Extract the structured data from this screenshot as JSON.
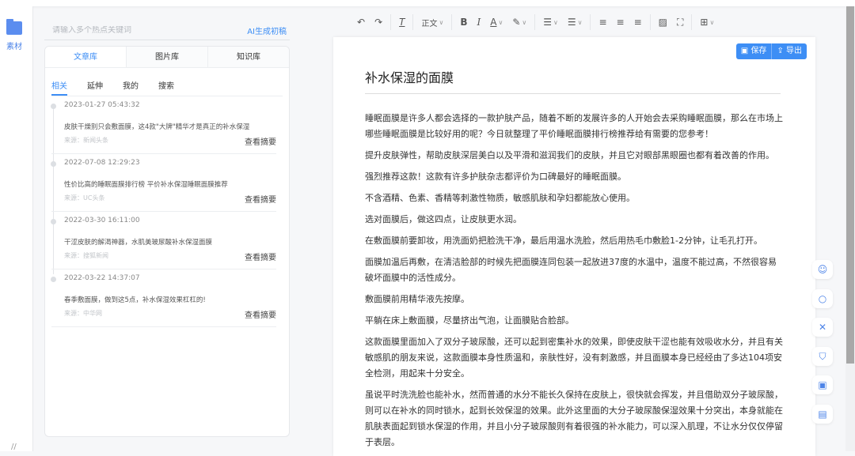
{
  "rail": {
    "label": "素材",
    "icon": "folder-icon"
  },
  "left": {
    "search_placeholder": "请输入多个热点关键词",
    "ai_button": "AI生成初稿",
    "tabs": [
      "文章库",
      "图片库",
      "知识库"
    ],
    "subtabs": [
      "相关",
      "延伸",
      "我的",
      "搜索"
    ],
    "items": [
      {
        "date": "2023-01-27 05:43:32",
        "title": "皮肤干燥别只会敷面膜，这4款\"大牌\"精华才是真正的补水保湿",
        "source": "来源：新闻头条",
        "action": "查看摘要"
      },
      {
        "date": "2022-07-08 12:29:23",
        "title": "性价比高的睡眠面膜排行榜 平价补水保湿睡眠面膜推荐",
        "source": "来源：UC头条",
        "action": "查看摘要"
      },
      {
        "date": "2022-03-30 16:11:00",
        "title": "干涩皮肤的解渴神器，水肌美玻尿酸补水保湿面膜",
        "source": "来源：搜狐新闻",
        "action": "查看摘要"
      },
      {
        "date": "2022-03-22 14:37:07",
        "title": "春季敷面膜，做到这5点，补水保湿效果杠杠的!",
        "source": "来源：中华网",
        "action": "查看摘要"
      }
    ]
  },
  "toolbar": {
    "paragraph_style": "正文"
  },
  "doc": {
    "save": "保存",
    "export": "导出",
    "title": "补水保湿的面膜",
    "paragraphs": [
      "睡眠面膜是许多人都会选择的一款护肤产品，随着不断的发展许多的人开始会去采购睡眠面膜，那么在市场上哪些睡眠面膜是比较好用的呢？今日就整理了平价睡眠面膜排行榜推荐给有需要的您参考！",
      "提升皮肤弹性，帮助皮肤深层美白以及平滑和滋润我们的皮肤，并且它对眼部黑眼圈也都有着改善的作用。",
      "强烈推荐这款！这款有许多护肤杂志都评价为口碑最好的睡眠面膜。",
      "不含酒精、色素、香精等刺激性物质，敏感肌肤和孕妇都能放心使用。",
      "选对面膜后，做这四点，让皮肤更水润。",
      "在敷面膜前要卸妆，用洗面奶把脸洗干净，最后用温水洗脸，然后用热毛巾敷脸1-2分钟，让毛孔打开。",
      "面膜加温后再敷，在清洁脸部的时候先把面膜连同包装一起放进37度的水温中，温度不能过高，不然很容易破坏面膜中的活性成分。",
      "敷面膜前用精华液先按摩。",
      "平躺在床上敷面膜，尽量挤出气泡，让面膜贴合脸部。",
      "这款面膜里面加入了双分子玻尿酸，还可以起到密集补水的效果，即使皮肤干涩也能有效吸收水分，并且有关敏感肌的朋友来说，这款面膜本身性质温和，亲肤性好，没有刺激感，并且面膜本身已经经由了多达104项安全检测，用起来十分安全。",
      "虽说平时洗洗脸也能补水，然而普通的水分不能长久保持在皮肤上，很快就会挥发，并且借助双分子玻尿酸，则可以在补水的同时锁水，起到长效保湿的效果。此外这里面的大分子玻尿酸保湿效果十分突出，本身就能在肌肤表面起到锁水保湿的作用，并且小分子玻尿酸则有着很强的补水能力，可以深入肌理，不让水分仅仅停留于表层。"
    ]
  },
  "side_tools": [
    "robot-icon",
    "search-icon",
    "graph-icon",
    "shield-icon",
    "text-icon",
    "comment-icon"
  ],
  "accent": "#3d8ef5"
}
